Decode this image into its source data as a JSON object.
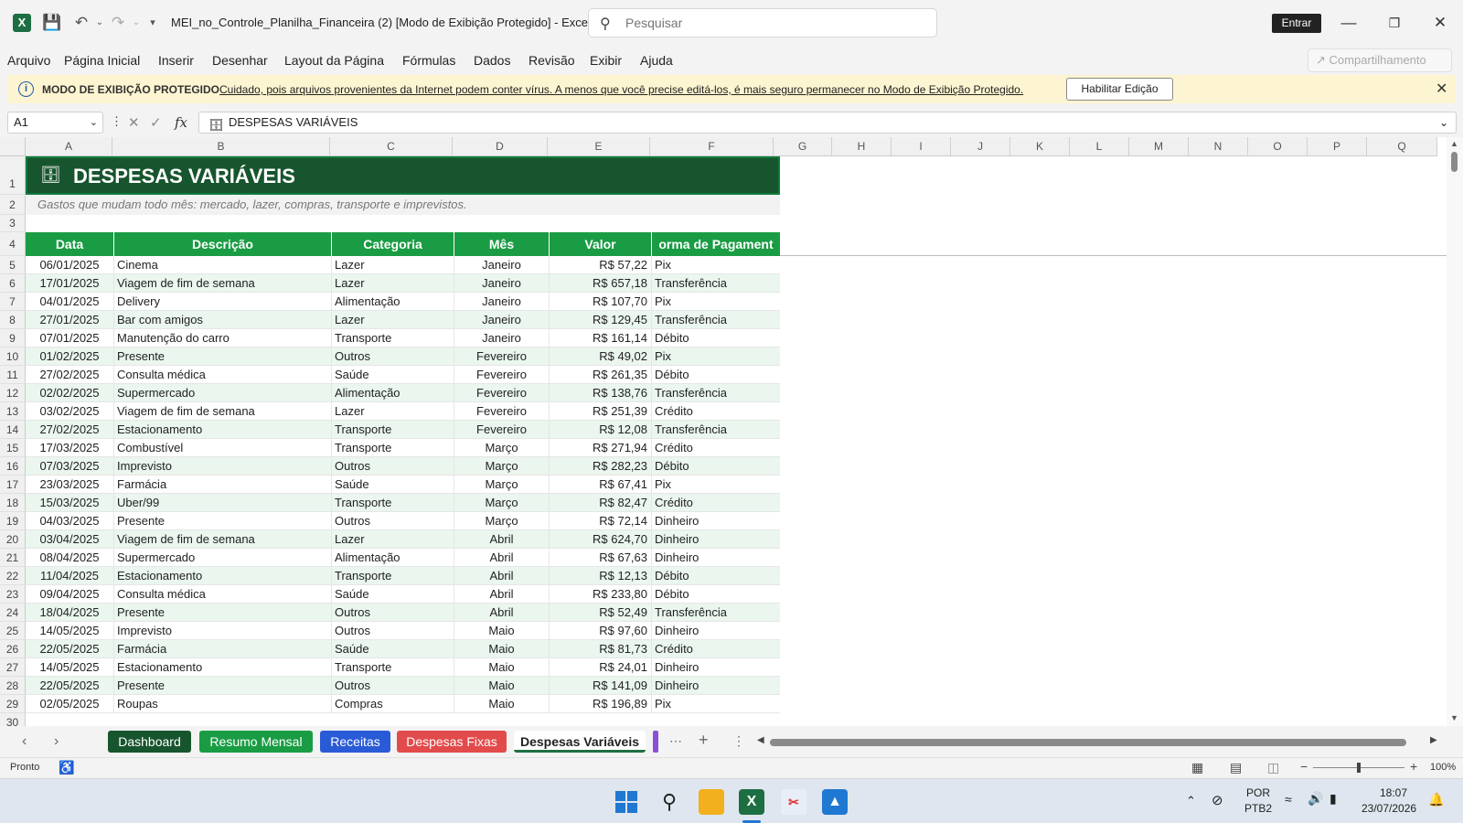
{
  "titlebar": {
    "doc_title": "MEI_no_Controle_Planilha_Financeira (2)  [Modo de Exibição Protegido]  -  Excel",
    "search_placeholder": "Pesquisar",
    "entrar_label": "Entrar"
  },
  "menu": {
    "items": [
      "Arquivo",
      "Página Inicial",
      "Inserir",
      "Desenhar",
      "Layout da Página",
      "Fórmulas",
      "Dados",
      "Revisão",
      "Exibir",
      "Ajuda"
    ],
    "share_label": "Compartilhamento"
  },
  "protected": {
    "title": "MODO DE EXIBIÇÃO PROTEGIDO",
    "message": "Cuidado, pois arquivos provenientes da Internet podem conter vírus. A menos que você precise editá-los, é mais seguro permanecer no Modo de  Exibição Protegido.",
    "button": "Habilitar Edição"
  },
  "formula_bar": {
    "name_box": "A1",
    "content": "DESPESAS VARIÁVEIS"
  },
  "sheet": {
    "columns": [
      "A",
      "B",
      "C",
      "D",
      "E",
      "F",
      "G",
      "H",
      "I",
      "J",
      "K",
      "L",
      "M",
      "N",
      "O",
      "P",
      "Q"
    ],
    "title": "DESPESAS VARIÁVEIS",
    "subtitle": "Gastos que mudam todo mês: mercado, lazer, compras, transporte e imprevistos.",
    "headers": [
      "Data",
      "Descrição",
      "Categoria",
      "Mês",
      "Valor",
      "orma de Pagament"
    ],
    "rows": [
      [
        "06/01/2025",
        "Cinema",
        "Lazer",
        "Janeiro",
        "R$ 57,22",
        "Pix"
      ],
      [
        "17/01/2025",
        "Viagem de fim de semana",
        "Lazer",
        "Janeiro",
        "R$ 657,18",
        "Transferência"
      ],
      [
        "04/01/2025",
        "Delivery",
        "Alimentação",
        "Janeiro",
        "R$ 107,70",
        "Pix"
      ],
      [
        "27/01/2025",
        "Bar com amigos",
        "Lazer",
        "Janeiro",
        "R$ 129,45",
        "Transferência"
      ],
      [
        "07/01/2025",
        "Manutenção do carro",
        "Transporte",
        "Janeiro",
        "R$ 161,14",
        "Débito"
      ],
      [
        "01/02/2025",
        "Presente",
        "Outros",
        "Fevereiro",
        "R$ 49,02",
        "Pix"
      ],
      [
        "27/02/2025",
        "Consulta médica",
        "Saúde",
        "Fevereiro",
        "R$ 261,35",
        "Débito"
      ],
      [
        "02/02/2025",
        "Supermercado",
        "Alimentação",
        "Fevereiro",
        "R$ 138,76",
        "Transferência"
      ],
      [
        "03/02/2025",
        "Viagem de fim de semana",
        "Lazer",
        "Fevereiro",
        "R$ 251,39",
        "Crédito"
      ],
      [
        "27/02/2025",
        "Estacionamento",
        "Transporte",
        "Fevereiro",
        "R$ 12,08",
        "Transferência"
      ],
      [
        "17/03/2025",
        "Combustível",
        "Transporte",
        "Março",
        "R$ 271,94",
        "Crédito"
      ],
      [
        "07/03/2025",
        "Imprevisto",
        "Outros",
        "Março",
        "R$ 282,23",
        "Débito"
      ],
      [
        "23/03/2025",
        "Farmácia",
        "Saúde",
        "Março",
        "R$ 67,41",
        "Pix"
      ],
      [
        "15/03/2025",
        "Uber/99",
        "Transporte",
        "Março",
        "R$ 82,47",
        "Crédito"
      ],
      [
        "04/03/2025",
        "Presente",
        "Outros",
        "Março",
        "R$ 72,14",
        "Dinheiro"
      ],
      [
        "03/04/2025",
        "Viagem de fim de semana",
        "Lazer",
        "Abril",
        "R$ 624,70",
        "Dinheiro"
      ],
      [
        "08/04/2025",
        "Supermercado",
        "Alimentação",
        "Abril",
        "R$ 67,63",
        "Dinheiro"
      ],
      [
        "11/04/2025",
        "Estacionamento",
        "Transporte",
        "Abril",
        "R$ 12,13",
        "Débito"
      ],
      [
        "09/04/2025",
        "Consulta médica",
        "Saúde",
        "Abril",
        "R$ 233,80",
        "Débito"
      ],
      [
        "18/04/2025",
        "Presente",
        "Outros",
        "Abril",
        "R$ 52,49",
        "Transferência"
      ],
      [
        "14/05/2025",
        "Imprevisto",
        "Outros",
        "Maio",
        "R$ 97,60",
        "Dinheiro"
      ],
      [
        "22/05/2025",
        "Farmácia",
        "Saúde",
        "Maio",
        "R$ 81,73",
        "Crédito"
      ],
      [
        "14/05/2025",
        "Estacionamento",
        "Transporte",
        "Maio",
        "R$ 24,01",
        "Dinheiro"
      ],
      [
        "22/05/2025",
        "Presente",
        "Outros",
        "Maio",
        "R$ 141,09",
        "Dinheiro"
      ],
      [
        "02/05/2025",
        "Roupas",
        "Compras",
        "Maio",
        "R$ 196,89",
        "Pix"
      ]
    ]
  },
  "tabs": [
    {
      "label": "Dashboard",
      "color": "#17552e"
    },
    {
      "label": "Resumo Mensal",
      "color": "#1a9c44"
    },
    {
      "label": "Receitas",
      "color": "#2a5bd7"
    },
    {
      "label": "Despesas Fixas",
      "color": "#e24b4b"
    },
    {
      "label": "Despesas Variáveis",
      "color": "#ffffff"
    }
  ],
  "status": {
    "ready": "Pronto",
    "zoom": "100%"
  },
  "taskbar": {
    "lang_top": "POR",
    "lang_bottom": "PTB2",
    "time": "18:07",
    "date": "23/07/2026"
  }
}
